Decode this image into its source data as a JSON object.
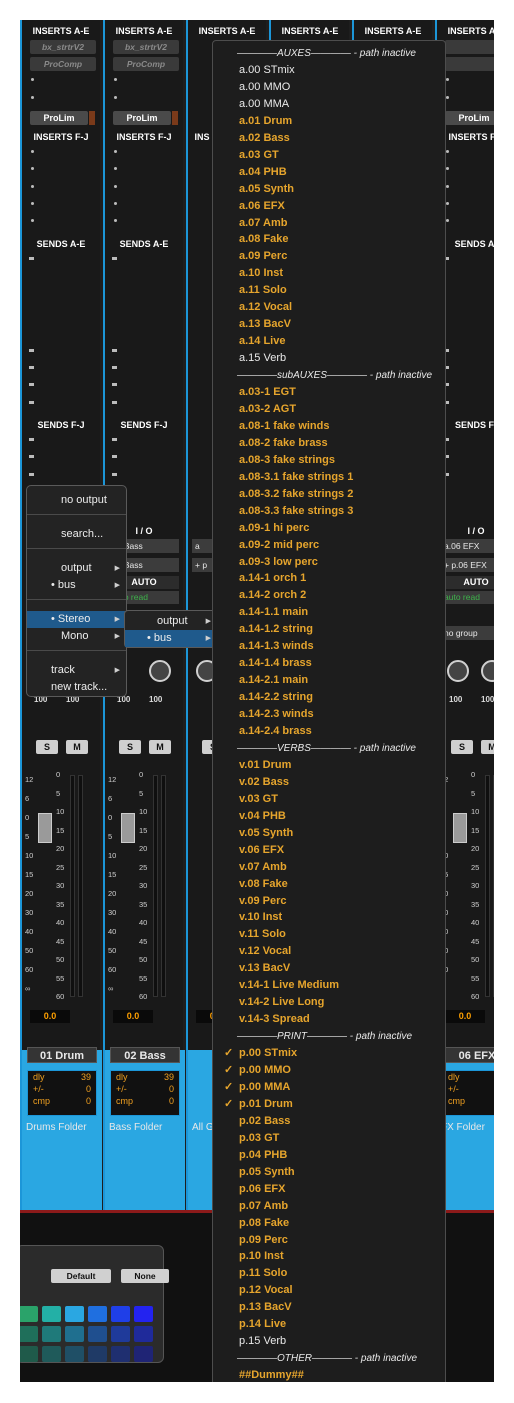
{
  "strips": [
    {
      "inserts_hdr": "INSERTS A-E",
      "plugins": [
        "bx_strtrV2",
        "ProComp"
      ],
      "limiter": "ProLim",
      "inserts_fj": "INSERTS F-J",
      "sends_ae": "SENDS A-E",
      "sends_fj": "SENDS F-J",
      "io": "",
      "output": "",
      "bus": "",
      "name": "01 Drum",
      "dly": "39",
      "pm": "0",
      "cmp": "0",
      "folder": "Drums Folder",
      "vol": "0.0",
      "pan_l": "100",
      "pan_r": "100"
    },
    {
      "inserts_hdr": "INSERTS A-E",
      "plugins": [
        "bx_strtrV2",
        "ProComp"
      ],
      "limiter": "ProLim",
      "inserts_fj": "INSERTS F-J",
      "sends_ae": "SENDS A-E",
      "sends_fj": "SENDS F-J",
      "io": "I / O",
      "output": "02 Bass",
      "bus": "02 Bass",
      "auto": "AUTO",
      "autoread": "auto read",
      "name": "02 Bass",
      "dly": "39",
      "pm": "0",
      "cmp": "0",
      "folder": "Bass Folder",
      "vol": "0.0",
      "pan_l": "100",
      "pan_r": "100"
    },
    {
      "inserts_hdr": "INSERTS A-E",
      "inserts_fj": "INS",
      "sends_ae": "SENDS A-E",
      "sends_fj": "SENDS F-J",
      "io": "",
      "output": "a",
      "bus": "+ p",
      "name": "",
      "folder": "All G",
      "vol": "0.0"
    },
    {
      "inserts_hdr": "INSERTS A-E"
    },
    {
      "inserts_hdr": "INSERTS A-E"
    },
    {
      "inserts_hdr": "INSERTS A-E",
      "limiter": "ProLim",
      "inserts_fj": "INSERTS F-J",
      "sends_ae": "SENDS A-",
      "sends_fj": "SENDS F-",
      "io": "I / O",
      "output": "a.06 EFX",
      "bus": "+ p.06 EFX",
      "auto": "AUTO",
      "autoread": "auto read",
      "group": "no group",
      "name": "06 EFX",
      "dly": "39",
      "pm": "0",
      "cmp": "0",
      "folder": "FX Folder",
      "vol": "0.0",
      "pan_l": "100",
      "pan_r": "100"
    }
  ],
  "labels": {
    "dly": "dly",
    "pm": "+/-",
    "cmp": "cmp",
    "solo": "S",
    "mute": "M"
  },
  "scale": [
    "12",
    "6",
    "0",
    "5",
    "10",
    "15",
    "20",
    "30",
    "40",
    "50",
    "60",
    "∞"
  ],
  "meter_scale": [
    "0",
    "5",
    "10",
    "15",
    "20",
    "25",
    "30",
    "35",
    "40",
    "45",
    "50",
    "55",
    "60"
  ],
  "color_panel": {
    "default_label": "Default",
    "none_label": "None",
    "swatches": [
      "#2aa36a",
      "#23b0a6",
      "#2aa7e2",
      "#1f6fe0",
      "#1f3fe8",
      "#2323f0",
      "#1f6f5a",
      "#1f7a7a",
      "#1f6f8f",
      "#1f4f8f",
      "#1f3a9a",
      "#1f2a9a",
      "#1f5a4a",
      "#1f5a5a",
      "#1f4f66",
      "#1f3a66",
      "#1f2f70",
      "#1f2475"
    ]
  },
  "context_menu": {
    "no_output": "no output",
    "search": "search...",
    "output": "output",
    "bus": "bus",
    "stereo": "Stereo",
    "mono": "Mono",
    "track": "track",
    "new_track": "new track...",
    "bullet": "•"
  },
  "submenu": {
    "output": "output",
    "bus": "bus",
    "bullet": "•"
  },
  "bus_menu": [
    {
      "t": "————AUXES———— - path inactive",
      "k": "sep"
    },
    {
      "t": "a.00 STmix",
      "k": "white"
    },
    {
      "t": "a.00 MMO",
      "k": "white"
    },
    {
      "t": "a.00 MMA",
      "k": "white"
    },
    {
      "t": "a.01 Drum",
      "k": "amber"
    },
    {
      "t": "a.02 Bass",
      "k": "amber"
    },
    {
      "t": "a.03 GT",
      "k": "amber"
    },
    {
      "t": "a.04 PHB",
      "k": "amber"
    },
    {
      "t": "a.05 Synth",
      "k": "amber"
    },
    {
      "t": "a.06 EFX",
      "k": "amber"
    },
    {
      "t": "a.07 Amb",
      "k": "amber"
    },
    {
      "t": "a.08 Fake",
      "k": "amber"
    },
    {
      "t": "a.09 Perc",
      "k": "amber"
    },
    {
      "t": "a.10 Inst",
      "k": "amber"
    },
    {
      "t": "a.11 Solo",
      "k": "amber"
    },
    {
      "t": "a.12 Vocal",
      "k": "amber"
    },
    {
      "t": "a.13 BacV",
      "k": "amber"
    },
    {
      "t": "a.14 Live",
      "k": "amber"
    },
    {
      "t": "a.15 Verb",
      "k": "white"
    },
    {
      "t": "————subAUXES———— - path inactive",
      "k": "sep"
    },
    {
      "t": "a.03-1 EGT",
      "k": "amber"
    },
    {
      "t": "a.03-2 AGT",
      "k": "amber"
    },
    {
      "t": "a.08-1 fake winds",
      "k": "amber"
    },
    {
      "t": "a.08-2 fake brass",
      "k": "amber"
    },
    {
      "t": "a.08-3 fake strings",
      "k": "amber"
    },
    {
      "t": "a.08-3.1 fake strings 1",
      "k": "amber"
    },
    {
      "t": "a.08-3.2 fake strings 2",
      "k": "amber"
    },
    {
      "t": "a.08-3.3 fake strings 3",
      "k": "amber"
    },
    {
      "t": "a.09-1 hi perc",
      "k": "amber"
    },
    {
      "t": "a.09-2 mid perc",
      "k": "amber"
    },
    {
      "t": "a.09-3 low perc",
      "k": "amber"
    },
    {
      "t": "a.14-1 orch 1",
      "k": "amber"
    },
    {
      "t": "a.14-2 orch 2",
      "k": "amber"
    },
    {
      "t": "a.14-1.1 main",
      "k": "amber"
    },
    {
      "t": "a.14-1.2 string",
      "k": "amber"
    },
    {
      "t": "a.14-1.3 winds",
      "k": "amber"
    },
    {
      "t": "a.14-1.4 brass",
      "k": "amber"
    },
    {
      "t": "a.14-2.1 main",
      "k": "amber"
    },
    {
      "t": "a.14-2.2 string",
      "k": "amber"
    },
    {
      "t": "a.14-2.3 winds",
      "k": "amber"
    },
    {
      "t": "a.14-2.4 brass",
      "k": "amber"
    },
    {
      "t": "————VERBS———— - path inactive",
      "k": "sep"
    },
    {
      "t": "v.01 Drum",
      "k": "amber"
    },
    {
      "t": "v.02 Bass",
      "k": "amber"
    },
    {
      "t": "v.03 GT",
      "k": "amber"
    },
    {
      "t": "v.04 PHB",
      "k": "amber"
    },
    {
      "t": "v.05 Synth",
      "k": "amber"
    },
    {
      "t": "v.06 EFX",
      "k": "amber"
    },
    {
      "t": "v.07 Amb",
      "k": "amber"
    },
    {
      "t": "v.08 Fake",
      "k": "amber"
    },
    {
      "t": "v.09 Perc",
      "k": "amber"
    },
    {
      "t": "v.10 Inst",
      "k": "amber"
    },
    {
      "t": "v.11 Solo",
      "k": "amber"
    },
    {
      "t": "v.12 Vocal",
      "k": "amber"
    },
    {
      "t": "v.13 BacV",
      "k": "amber"
    },
    {
      "t": "v.14-1 Live Medium",
      "k": "amber"
    },
    {
      "t": "v.14-2 Live Long",
      "k": "amber"
    },
    {
      "t": "v.14-3 Spread",
      "k": "amber"
    },
    {
      "t": "————PRINT———— - path inactive",
      "k": "sep"
    },
    {
      "t": "p.00 STmix",
      "k": "amber",
      "check": true
    },
    {
      "t": "p.00 MMO",
      "k": "amber",
      "check": true
    },
    {
      "t": "p.00 MMA",
      "k": "amber",
      "check": true
    },
    {
      "t": "p.01 Drum",
      "k": "amber",
      "check": true
    },
    {
      "t": "p.02 Bass",
      "k": "amber"
    },
    {
      "t": "p.03 GT",
      "k": "amber"
    },
    {
      "t": "p.04 PHB",
      "k": "amber"
    },
    {
      "t": "p.05 Synth",
      "k": "amber"
    },
    {
      "t": "p.06 EFX",
      "k": "amber"
    },
    {
      "t": "p.07 Amb",
      "k": "amber"
    },
    {
      "t": "p.08 Fake",
      "k": "amber"
    },
    {
      "t": "p.09 Perc",
      "k": "amber"
    },
    {
      "t": "p.10 Inst",
      "k": "amber"
    },
    {
      "t": "p.11 Solo",
      "k": "amber"
    },
    {
      "t": "p.12 Vocal",
      "k": "amber"
    },
    {
      "t": "p.13 BacV",
      "k": "amber"
    },
    {
      "t": "p.14 Live",
      "k": "amber"
    },
    {
      "t": "p.15 Verb",
      "k": "white"
    },
    {
      "t": "————OTHER———— - path inactive",
      "k": "sep"
    },
    {
      "t": "##Dummy##",
      "k": "amber"
    }
  ],
  "check_mark": "✓",
  "colors": {
    "accent_blue": "#1c96d8",
    "menu_amber": "#e6a52d",
    "menu_bg": "#1d1d1d",
    "selection": "#1f5a8c"
  }
}
